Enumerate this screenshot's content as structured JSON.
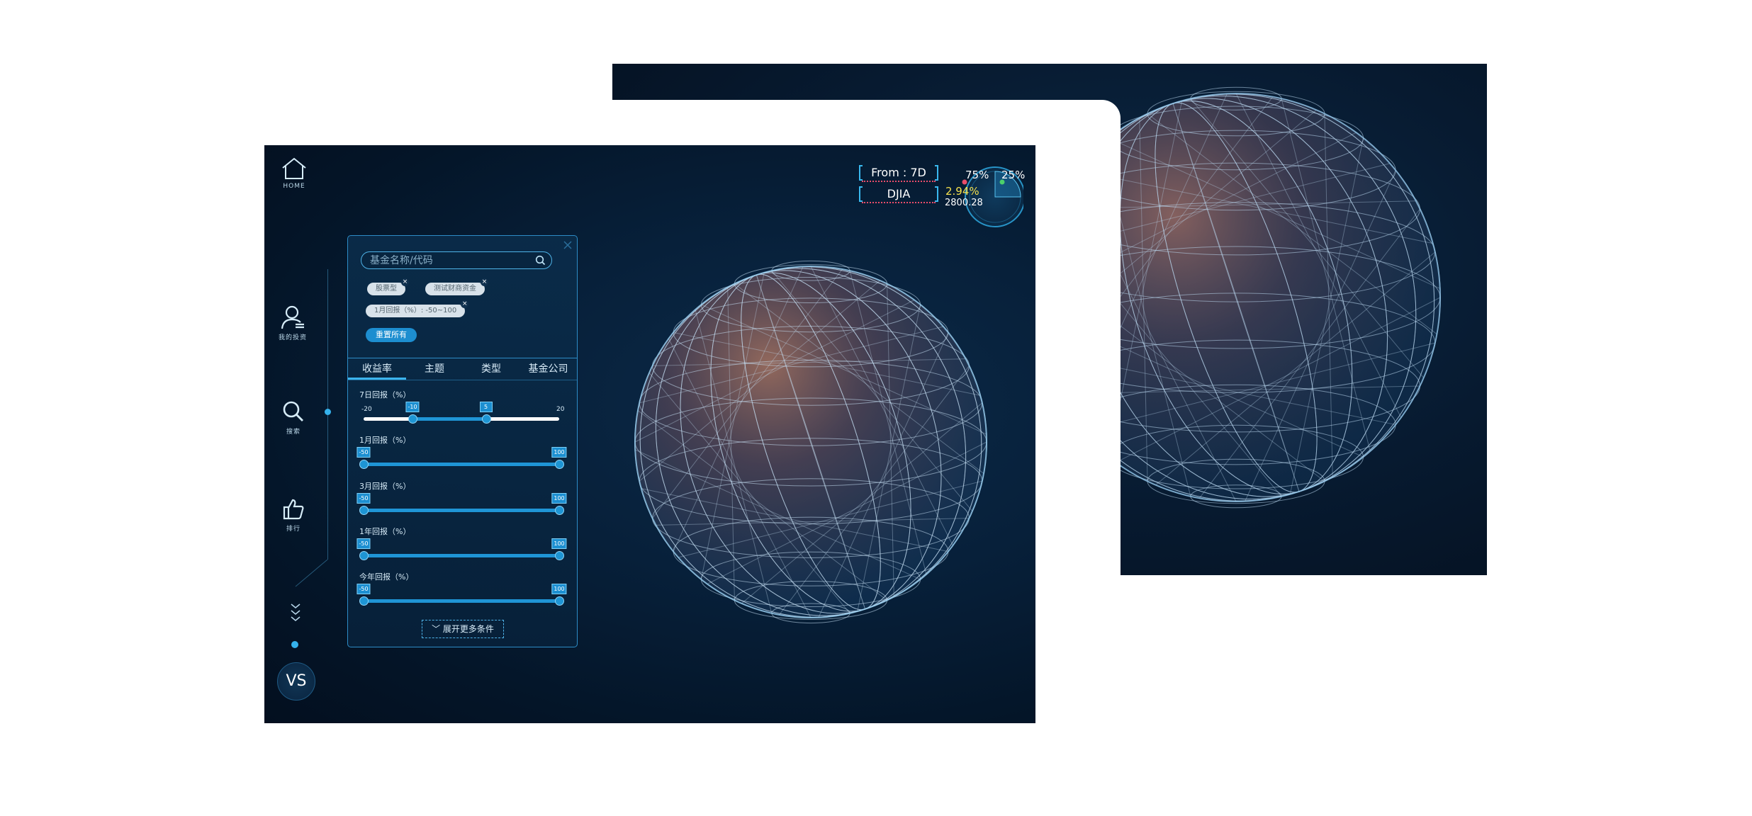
{
  "nav": {
    "home_label": "HOME",
    "portfolio_label": "我的投资",
    "search_label": "搜索",
    "ranking_label": "排行",
    "vs_label": "VS"
  },
  "filter": {
    "search_placeholder": "基金名称/代码",
    "tags": [
      "股票型",
      "测试财商资金",
      "1月回报（%）: -50~100"
    ],
    "reset_label": "重置所有",
    "tabs": [
      "收益率",
      "主题",
      "类型",
      "基金公司"
    ],
    "active_tab": "收益率",
    "ranges": [
      {
        "title": "7日回报（%）",
        "min_label": "-20",
        "max_label": "20",
        "low": -10,
        "high": 5,
        "min": -20,
        "max": 20,
        "low_label": "-10",
        "high_label": "5"
      },
      {
        "title": "1月回报（%）",
        "min_label": "",
        "max_label": "",
        "low": -50,
        "high": 100,
        "min": -50,
        "max": 100,
        "low_label": "-50",
        "high_label": "100"
      },
      {
        "title": "3月回报（%）",
        "min_label": "",
        "max_label": "",
        "low": -50,
        "high": 100,
        "min": -50,
        "max": 100,
        "low_label": "-50",
        "high_label": "100"
      },
      {
        "title": "1年回报（%）",
        "min_label": "",
        "max_label": "",
        "low": -50,
        "high": 100,
        "min": -50,
        "max": 100,
        "low_label": "-50",
        "high_label": "100"
      },
      {
        "title": "今年回报（%）",
        "min_label": "",
        "max_label": "",
        "low": -50,
        "high": 100,
        "min": -50,
        "max": 100,
        "low_label": "-50",
        "high_label": "100"
      }
    ],
    "expand_label": "展开更多条件"
  },
  "hud": {
    "period_label": "From : 7D",
    "index_label": "DJIA",
    "left_pct": "75%",
    "right_pct": "25%",
    "change": "2.94%",
    "value": "2800.28",
    "colors": {
      "accent": "#39b8ee",
      "up": "#f4e04d",
      "dot_red": "#e94d6a",
      "dot_green": "#4ccf6b"
    }
  }
}
